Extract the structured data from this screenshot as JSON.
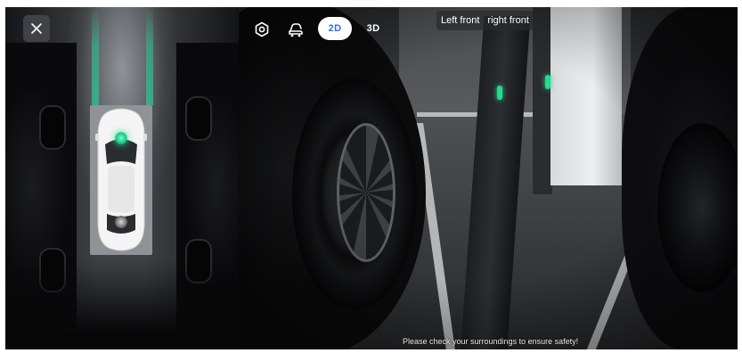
{
  "close_button": {
    "icon": "close-icon"
  },
  "toolbar": {
    "settings_icon": "settings-hex-icon",
    "view_icon": "car-camera-icon",
    "view_2d_label": "2D",
    "view_3d_label": "3D",
    "active_view": "2D",
    "active_color": "#2d6cf0"
  },
  "camera_tabs": [
    {
      "label": "Left front"
    },
    {
      "label": "right front"
    }
  ],
  "safety_banner": "Please check your surroundings to ensure safety!",
  "colors": {
    "guide_green": "#28c896",
    "sensor_active": "#18c98a"
  }
}
